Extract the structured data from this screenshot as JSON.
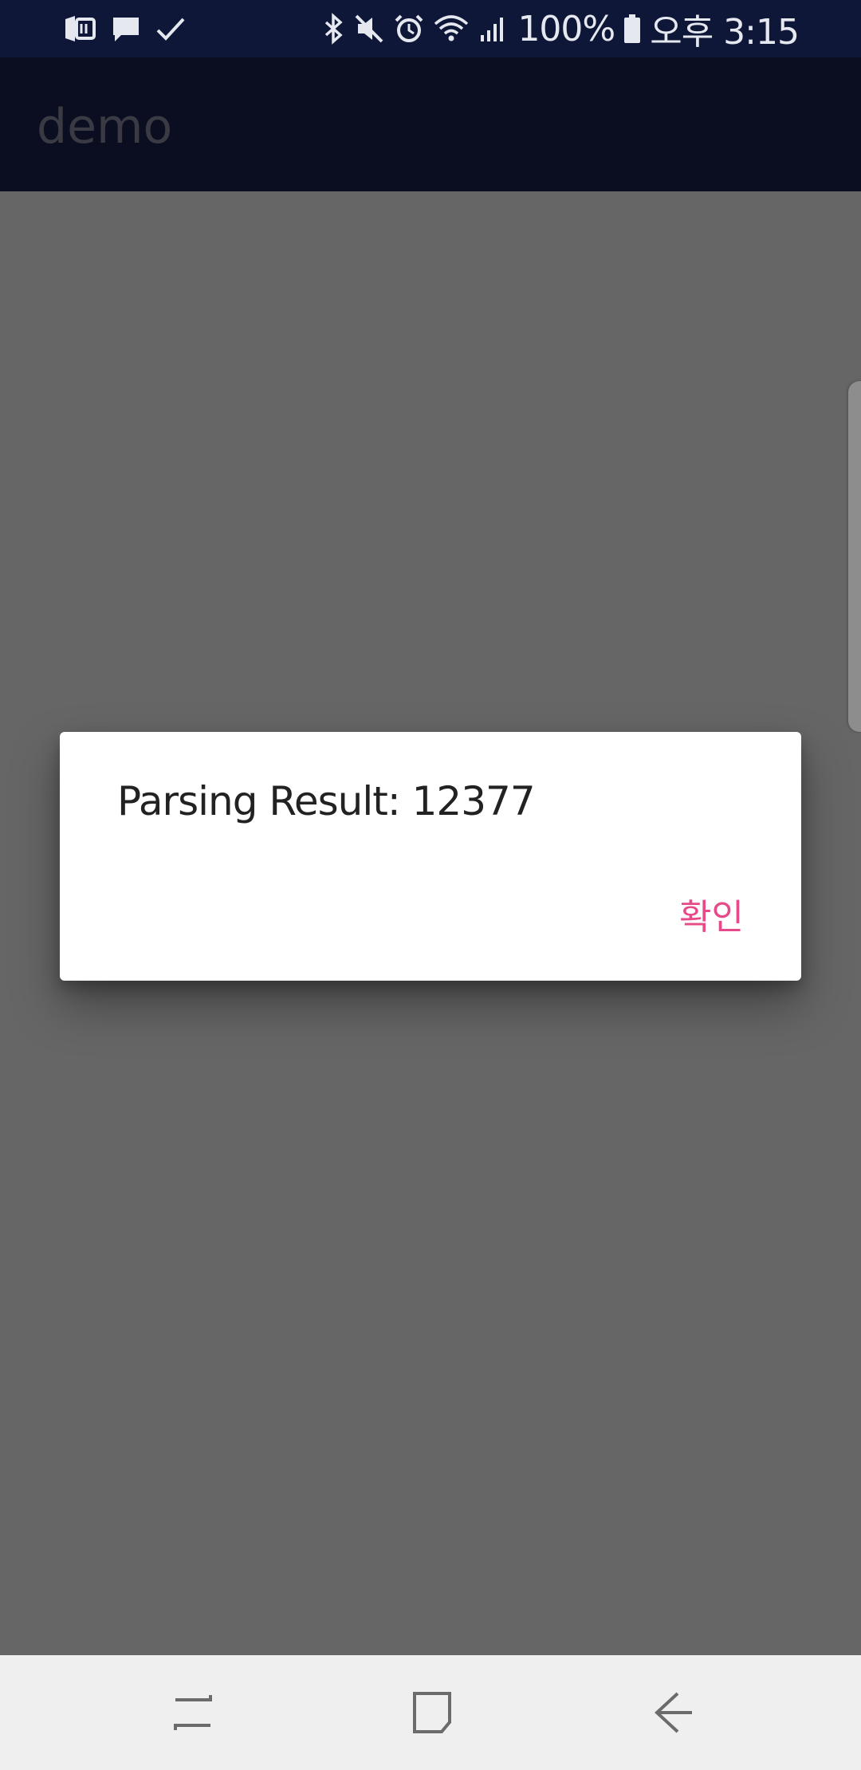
{
  "status_bar": {
    "left_icons": [
      "app-notification-icon",
      "message-icon",
      "check-icon"
    ],
    "right_icons": [
      "bluetooth-icon",
      "mute-icon",
      "alarm-icon",
      "wifi-icon",
      "signal-icon"
    ],
    "battery_percent": "100%",
    "time": "오후 3:15",
    "text_color": "#e6e8f0"
  },
  "app_bar": {
    "title": "demo",
    "background": "#1c2350"
  },
  "dialog": {
    "message": "Parsing Result: 12377",
    "ok_label": "확인",
    "accent": "#e64a88"
  },
  "nav_bar": {
    "buttons": [
      "recent-apps-icon",
      "home-icon",
      "back-icon"
    ],
    "background": "#efefef"
  }
}
